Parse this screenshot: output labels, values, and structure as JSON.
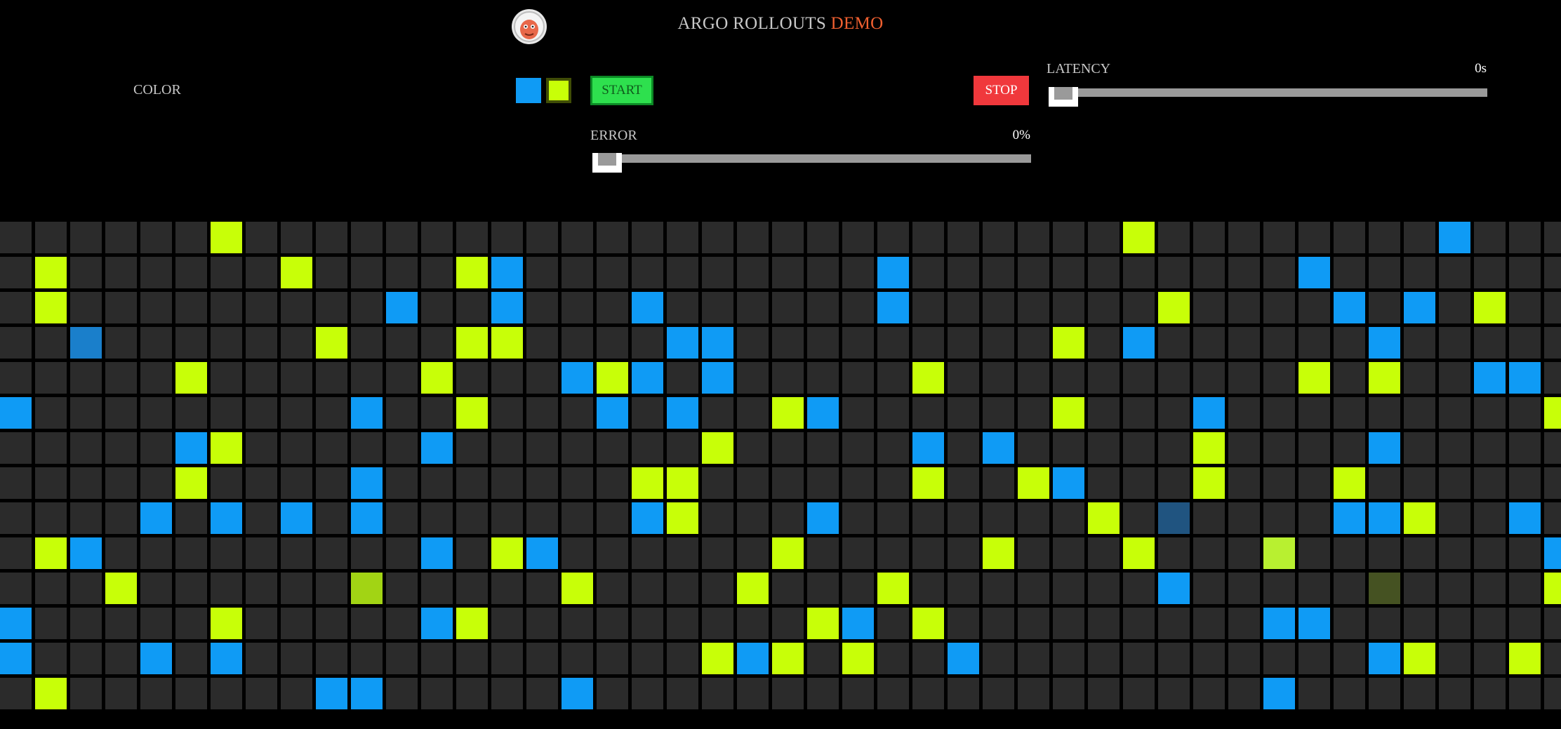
{
  "header": {
    "title_main": "ARGO ROLLOUTS",
    "title_accent": "DEMO",
    "accent_color": "#f06030"
  },
  "controls": {
    "color_label": "COLOR",
    "swatches": [
      {
        "name": "blue",
        "color": "#0f9bf5"
      },
      {
        "name": "green",
        "color": "#c8ff08",
        "selected": true
      }
    ],
    "start_label": "START",
    "stop_label": "STOP",
    "latency": {
      "label": "LATENCY",
      "value_text": "0s",
      "value": 0
    },
    "error": {
      "label": "ERROR",
      "value_text": "0%",
      "value": 0
    }
  },
  "grid": {
    "columns": 45,
    "rows": 14,
    "legend": {
      ".": "#2b2b2b",
      "B": "#0f9bf5",
      "G": "#c8ff08",
      "b": "#1a7fcb",
      "d": "#205480",
      "g": "#a2d414",
      "l": "#b8f030",
      "o": "#455222"
    },
    "rows_data": [
      "......G.........................G........B.",
      ".G......G....GB..........B...........B.....",
      ".G.........B..B...B......B.......G....B.B.G.",
      "..b......G...GG....BB.........G.B......B....",
      ".....G......G...BGB.B.....G..........G.G..BB.",
      "B.........B..G...B.B..GB......G...B.........GB",
      ".....BG.....B.......G.....B.B.....G....B.....",
      ".....G....B.......GG......G..GB...G...G.......",
      "....B.B.B.B.......BG...B.......G.d....BBG..B...GGG",
      ".GB.........B.GB......G.....G...G...l.......B.....G",
      "...G......g.....G....G...G.......B.....o....G...G...B",
      "B.....G.....BG.........GB.G.........BB.............BG",
      "B...B.B.............GBG.G..B...........BG..G..B..G..",
      ".G.......BB.....B...................B.........B..B....BB.B....B....G"
    ]
  }
}
